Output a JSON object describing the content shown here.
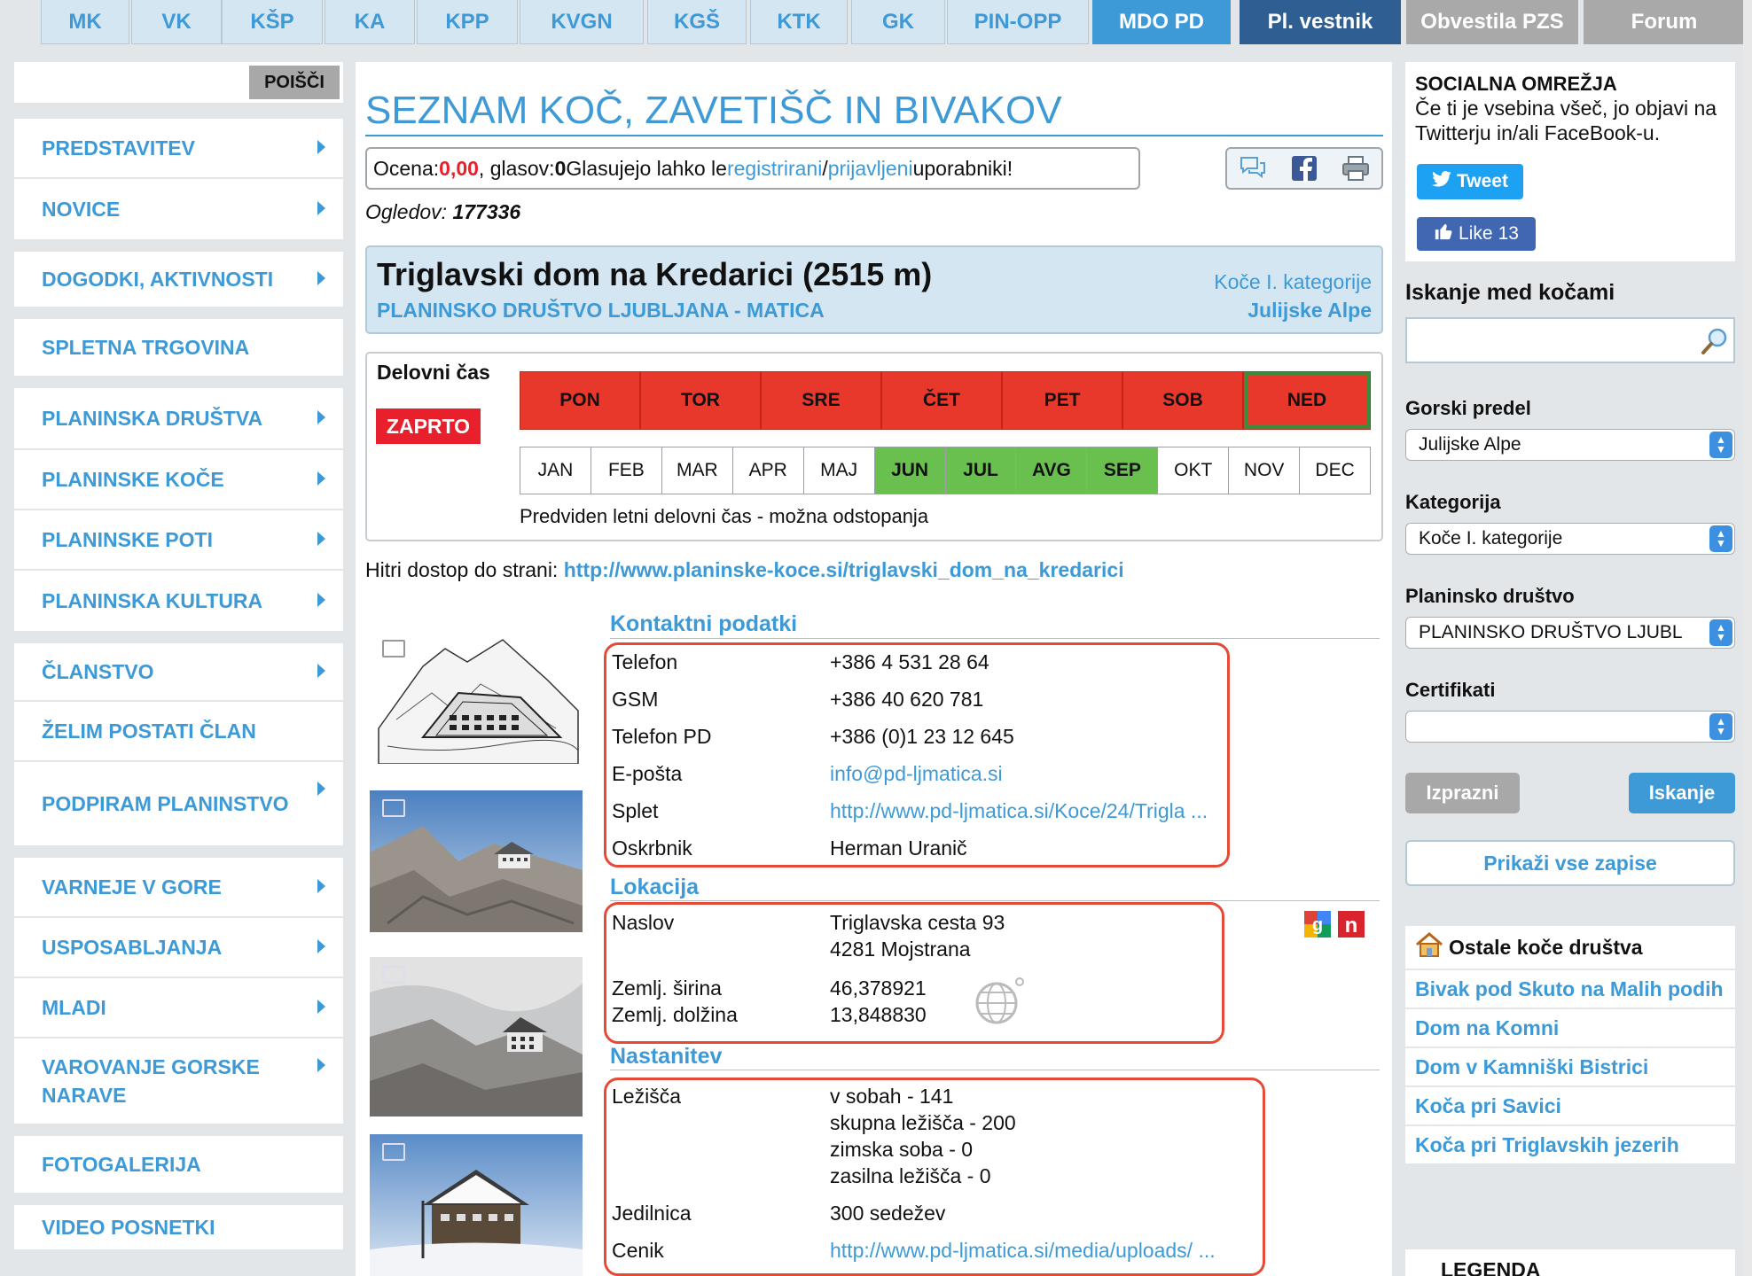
{
  "top_tabs": [
    {
      "label": "MK",
      "style": "normal"
    },
    {
      "label": "VK",
      "style": "normal"
    },
    {
      "label": "KŠP",
      "style": "normal"
    },
    {
      "label": "KA",
      "style": "normal"
    },
    {
      "label": "KPP",
      "style": "normal"
    },
    {
      "label": "KVGN",
      "style": "normal"
    },
    {
      "label": "KGŠ",
      "style": "normal"
    },
    {
      "label": "KTK",
      "style": "normal"
    },
    {
      "label": "GK",
      "style": "normal"
    },
    {
      "label": "PIN-OPP",
      "style": "normal"
    },
    {
      "label": "MDO PD",
      "style": "active"
    },
    {
      "label": "Pl. vestnik",
      "style": "dark"
    },
    {
      "label": "Obvestila PZS",
      "style": "gray"
    },
    {
      "label": "Forum",
      "style": "gray"
    }
  ],
  "left": {
    "search_button": "POIŠČI",
    "nav_groups": [
      [
        {
          "label": "PREDSTAVITEV",
          "arrow": true
        },
        {
          "label": "NOVICE",
          "arrow": true
        }
      ],
      [
        {
          "label": "DOGODKI, AKTIVNOSTI",
          "arrow": true
        }
      ],
      [
        {
          "label": "SPLETNA TRGOVINA",
          "arrow": false
        }
      ],
      [
        {
          "label": "PLANINSKA DRUŠTVA",
          "arrow": true
        },
        {
          "label": "PLANINSKE KOČE",
          "arrow": true
        },
        {
          "label": "PLANINSKE POTI",
          "arrow": true
        },
        {
          "label": "PLANINSKA KULTURA",
          "arrow": true
        }
      ],
      [
        {
          "label": "ČLANSTVO",
          "arrow": true
        },
        {
          "label": "ŽELIM POSTATI ČLAN",
          "arrow": false
        },
        {
          "label": "PODPIRAM PLANINSTVO",
          "arrow": true
        }
      ],
      [
        {
          "label": "VARNEJE V GORE",
          "arrow": true
        },
        {
          "label": "USPOSABLJANJA",
          "arrow": true
        },
        {
          "label": "MLADI",
          "arrow": true
        },
        {
          "label": "VAROVANJE GORSKE NARAVE",
          "arrow": true
        }
      ],
      [
        {
          "label": "FOTOGALERIJA",
          "arrow": false
        }
      ],
      [
        {
          "label": "VIDEO POSNETKI",
          "arrow": false
        }
      ]
    ]
  },
  "main": {
    "page_title": "SEZNAM KOČ, ZAVETIŠČ IN BIVAKOV",
    "rating": {
      "prefix": "Ocena: ",
      "value": "0,00",
      "votes_prefix": ", glasov: ",
      "votes": "0",
      "text": " Glasujejo lahko le ",
      "registered_link": "registrirani",
      "separator": " / ",
      "logged_link": "prijavljeni",
      "suffix": " uporabniki!"
    },
    "views_label": "Ogledov: ",
    "views_value": "177336",
    "hut": {
      "name": "Triglavski dom na Kredarici (2515 m)",
      "society": "PLANINSKO DRUŠTVO LJUBLJANA - MATICA",
      "category": "Koče I. kategorije",
      "region": "Julijske Alpe"
    },
    "working": {
      "label": "Delovni čas",
      "status": "ZAPRTO",
      "days": [
        "PON",
        "TOR",
        "SRE",
        "ČET",
        "PET",
        "SOB",
        "NED"
      ],
      "months": [
        {
          "label": "JAN",
          "open": false
        },
        {
          "label": "FEB",
          "open": false
        },
        {
          "label": "MAR",
          "open": false
        },
        {
          "label": "APR",
          "open": false
        },
        {
          "label": "MAJ",
          "open": false
        },
        {
          "label": "JUN",
          "open": true
        },
        {
          "label": "JUL",
          "open": true
        },
        {
          "label": "AVG",
          "open": true
        },
        {
          "label": "SEP",
          "open": true
        },
        {
          "label": "OKT",
          "open": false
        },
        {
          "label": "NOV",
          "open": false
        },
        {
          "label": "DEC",
          "open": false
        }
      ],
      "note": "Predviden letni delovni čas - možna odstopanja"
    },
    "quick_access_label": "Hitri dostop do strani: ",
    "quick_access_url": "http://www.planinske-koce.si/triglavski_dom_na_kredarici",
    "contact": {
      "title": "Kontaktni podatki",
      "rows": [
        {
          "label": "Telefon",
          "value": "+386 4 531 28 64",
          "link": false
        },
        {
          "label": "GSM",
          "value": "+386 40 620 781",
          "link": false
        },
        {
          "label": "Telefon PD",
          "value": "+386 (0)1 23 12 645",
          "link": false
        },
        {
          "label": "E-pošta",
          "value": "info@pd-ljmatica.si",
          "link": true
        },
        {
          "label": "Splet",
          "value": "http://www.pd-ljmatica.si/Koce/24/Trigla ...",
          "link": true
        },
        {
          "label": "Oskrbnik",
          "value": "Herman Uranič",
          "link": false
        }
      ]
    },
    "location": {
      "title": "Lokacija",
      "address_label": "Naslov",
      "address_line1": "Triglavska cesta 93",
      "address_line2": "4281 Mojstrana",
      "lat_label": "Zemlj. širina",
      "lat_value": "46,378921",
      "lon_label": "Zemlj. dolžina",
      "lon_value": "13,848830"
    },
    "lodging": {
      "title": "Nastanitev",
      "beds_label": "Ležišča",
      "beds": [
        "v sobah - 141",
        "skupna ležišča - 200",
        "zimska soba - 0",
        "zasilna ležišča - 0"
      ],
      "dining_label": "Jedilnica",
      "dining_value": "300 sedežev",
      "price_label": "Cenik",
      "price_value": "http://www.pd-ljmatica.si/media/uploads/ ..."
    }
  },
  "right": {
    "social_title": "SOCIALNA OMREŽJA",
    "social_text": "Če ti je vsebina všeč, jo objavi na Twitterju in/ali FaceBook-u.",
    "tweet_label": "Tweet",
    "like_label": "Like",
    "like_count": "13",
    "search_heading": "Iskanje med kočami",
    "region_label": "Gorski predel",
    "region_value": "Julijske Alpe",
    "category_label": "Kategorija",
    "category_value": "Koče I. kategorije",
    "society_label": "Planinsko društvo",
    "society_value": "PLANINSKO DRUŠTVO LJUBL",
    "cert_label": "Certifikati",
    "cert_value": "",
    "clear_button": "Izprazni",
    "search_button": "Iskanje",
    "show_all_button": "Prikaži vse zapise",
    "other_huts_title": "Ostale koče društva",
    "other_huts": [
      "Bivak pod Skuto na Malih podih",
      "Dom na Komni",
      "Dom v Kamniški Bistrici",
      "Koča pri Savici",
      "Koča pri Triglavskih jezerih"
    ],
    "legend_title": "LEGENDA"
  },
  "colors": {
    "accent": "#3d9ad6",
    "closed": "#e8202c",
    "open_month": "#6ac04f",
    "highlight_box": "#e64a36"
  }
}
